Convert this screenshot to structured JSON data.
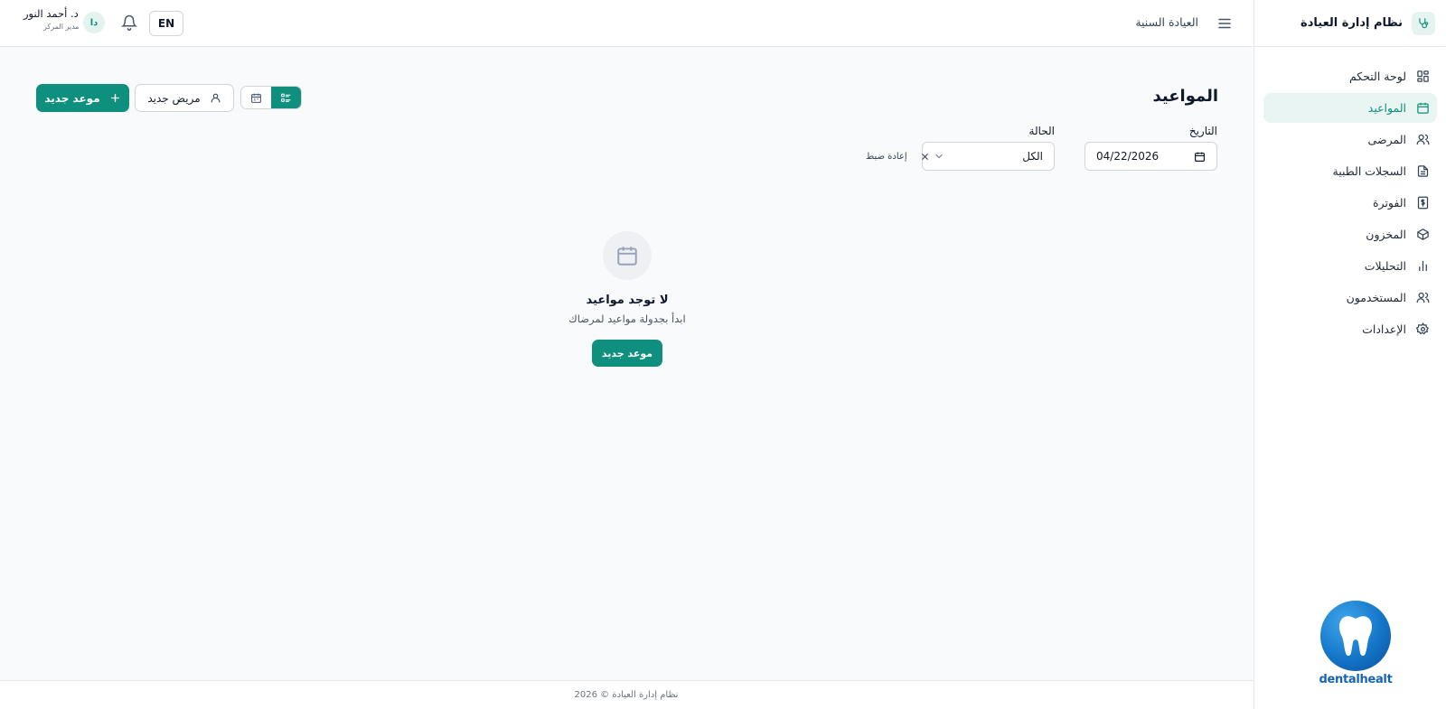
{
  "sidebar": {
    "brand_title": "نظام إدارة العيادة",
    "brand_icon": "stethoscope-icon",
    "items": [
      {
        "label": "لوحة التحكم",
        "icon": "grid-icon",
        "active": false
      },
      {
        "label": "المواعيد",
        "icon": "calendar-icon",
        "active": true
      },
      {
        "label": "المرضى",
        "icon": "users-icon",
        "active": false
      },
      {
        "label": "السجلات الطبية",
        "icon": "file-text-icon",
        "active": false
      },
      {
        "label": "الفوترة",
        "icon": "dollar-icon",
        "active": false
      },
      {
        "label": "المخزون",
        "icon": "box-icon",
        "active": false
      },
      {
        "label": "التحليلات",
        "icon": "bar-chart-icon",
        "active": false
      },
      {
        "label": "المستخدمون",
        "icon": "users-icon",
        "active": false
      },
      {
        "label": "الإعدادات",
        "icon": "gear-icon",
        "active": false
      }
    ],
    "logo_text": "dentalhealt"
  },
  "header": {
    "clinic_name": "العيادة السنية",
    "user_name": "د. أحمد النور",
    "user_role": "مدير المركز",
    "avatar_initials": "دا",
    "lang_label": "EN"
  },
  "main": {
    "title": "المواعيد",
    "new_appointment_label": "موعد جديد",
    "new_patient_label": "مريض جديد",
    "filters": {
      "date_label": "التاريخ",
      "date_value": "04/22/2026",
      "status_label": "الحالة",
      "status_value": "الكل",
      "reset_label": "إعادة ضبط"
    },
    "empty": {
      "title": "لا توجد مواعيد",
      "subtitle": "ابدأ بجدولة مواعيد لمرضاك",
      "button_label": "موعد جديد"
    }
  },
  "footer": {
    "text": "نظام إدارة العيادة © 2026"
  },
  "colors": {
    "accent": "#0f8f7d",
    "active_bg": "#e8f5f2",
    "background": "#f8fafc"
  }
}
